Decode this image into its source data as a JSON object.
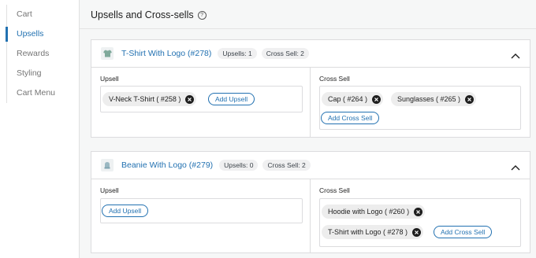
{
  "sidebar": {
    "items": [
      {
        "label": "Cart"
      },
      {
        "label": "Upsells"
      },
      {
        "label": "Rewards"
      },
      {
        "label": "Styling"
      },
      {
        "label": "Cart Menu"
      }
    ]
  },
  "header": {
    "title": "Upsells and Cross-sells",
    "help_icon": "?"
  },
  "products": [
    {
      "title": "T-Shirt With Logo (#278)",
      "upsells_badge": "Upsells: 1",
      "cross_sell_badge": "Cross Sell: 2",
      "upsell_label": "Upsell",
      "cross_sell_label": "Cross Sell",
      "upsells": [
        "V-Neck T-Shirt ( #258 )"
      ],
      "cross_sells": [
        "Cap ( #264 )",
        "Sunglasses ( #265 )"
      ],
      "add_upsell_label": "Add Upsell",
      "add_cross_sell_label": "Add Cross Sell"
    },
    {
      "title": "Beanie With Logo (#279)",
      "upsells_badge": "Upsells: 0",
      "cross_sell_badge": "Cross Sell: 2",
      "upsell_label": "Upsell",
      "cross_sell_label": "Cross Sell",
      "upsells": [],
      "cross_sells": [
        "Hoodie with Logo ( #260 )",
        "T-Shirt with Logo ( #278 )"
      ],
      "add_upsell_label": "Add Upsell",
      "add_cross_sell_label": "Add Cross Sell"
    }
  ],
  "colors": {
    "accent": "#2271b1",
    "chip": "#ededed",
    "border": "#dcdcde"
  }
}
